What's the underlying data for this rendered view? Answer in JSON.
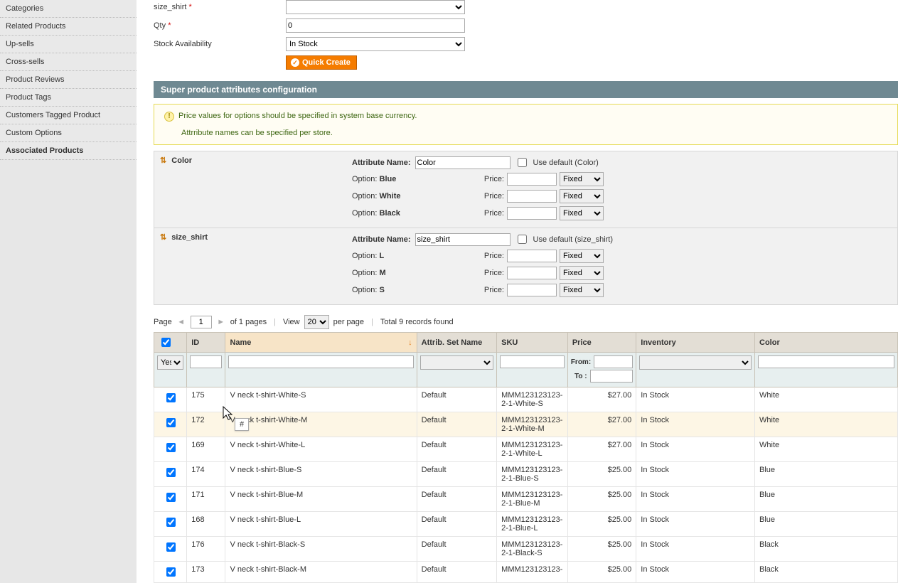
{
  "sidebar": {
    "items": [
      {
        "label": "Categories"
      },
      {
        "label": "Related Products"
      },
      {
        "label": "Up-sells"
      },
      {
        "label": "Cross-sells"
      },
      {
        "label": "Product Reviews"
      },
      {
        "label": "Product Tags"
      },
      {
        "label": "Customers Tagged Product"
      },
      {
        "label": "Custom Options"
      },
      {
        "label": "Associated Products"
      }
    ]
  },
  "form": {
    "size_label": "size_shirt",
    "qty_label": "Qty",
    "qty_value": "0",
    "stock_label": "Stock Availability",
    "stock_value": "In Stock",
    "quick_create": "Quick Create"
  },
  "section_title": "Super product attributes configuration",
  "notice": {
    "line1": "Price values for options should be specified in system base currency.",
    "line2": "Attrribute names can be specified per store."
  },
  "attrs": {
    "attr_name_label": "Attribute Name:",
    "use_default_prefix": "Use default",
    "option_label": "Option:",
    "price_label": "Price:",
    "fixed": "Fixed",
    "color": {
      "title": "Color",
      "name_value": "Color",
      "default_suffix": "(Color)",
      "opts": [
        "Blue",
        "White",
        "Black"
      ]
    },
    "size": {
      "title": "size_shirt",
      "name_value": "size_shirt",
      "default_suffix": "(size_shirt)",
      "opts": [
        "L",
        "M",
        "S"
      ]
    }
  },
  "pager": {
    "page_label": "Page",
    "page_value": "1",
    "of_pages": "of 1 pages",
    "view_label": "View",
    "per_page_value": "20",
    "per_page_suffix": "per page",
    "total": "Total 9 records found"
  },
  "grid": {
    "headers": {
      "id": "ID",
      "name": "Name",
      "set": "Attrib. Set Name",
      "sku": "SKU",
      "price": "Price",
      "inventory": "Inventory",
      "color": "Color"
    },
    "filter": {
      "yes": "Yes",
      "from": "From:",
      "to": "To :"
    },
    "rows": [
      {
        "id": "175",
        "name": "V neck t-shirt-White-S",
        "set": "Default",
        "sku": "MMM123123123-2-1-White-S",
        "price": "$27.00",
        "inv": "In Stock",
        "color": "White",
        "hl": false
      },
      {
        "id": "172",
        "name": "V neck t-shirt-White-M",
        "set": "Default",
        "sku": "MMM123123123-2-1-White-M",
        "price": "$27.00",
        "inv": "In Stock",
        "color": "White",
        "hl": true
      },
      {
        "id": "169",
        "name": "V neck t-shirt-White-L",
        "set": "Default",
        "sku": "MMM123123123-2-1-White-L",
        "price": "$27.00",
        "inv": "In Stock",
        "color": "White",
        "hl": false
      },
      {
        "id": "174",
        "name": "V neck t-shirt-Blue-S",
        "set": "Default",
        "sku": "MMM123123123-2-1-Blue-S",
        "price": "$25.00",
        "inv": "In Stock",
        "color": "Blue",
        "hl": false
      },
      {
        "id": "171",
        "name": "V neck t-shirt-Blue-M",
        "set": "Default",
        "sku": "MMM123123123-2-1-Blue-M",
        "price": "$25.00",
        "inv": "In Stock",
        "color": "Blue",
        "hl": false
      },
      {
        "id": "168",
        "name": "V neck t-shirt-Blue-L",
        "set": "Default",
        "sku": "MMM123123123-2-1-Blue-L",
        "price": "$25.00",
        "inv": "In Stock",
        "color": "Blue",
        "hl": false
      },
      {
        "id": "176",
        "name": "V neck t-shirt-Black-S",
        "set": "Default",
        "sku": "MMM123123123-2-1-Black-S",
        "price": "$25.00",
        "inv": "In Stock",
        "color": "Black",
        "hl": false
      },
      {
        "id": "173",
        "name": "V neck t-shirt-Black-M",
        "set": "Default",
        "sku": "MMM123123123-",
        "price": "$25.00",
        "inv": "In Stock",
        "color": "Black",
        "hl": false
      }
    ]
  },
  "tooltip": "#"
}
